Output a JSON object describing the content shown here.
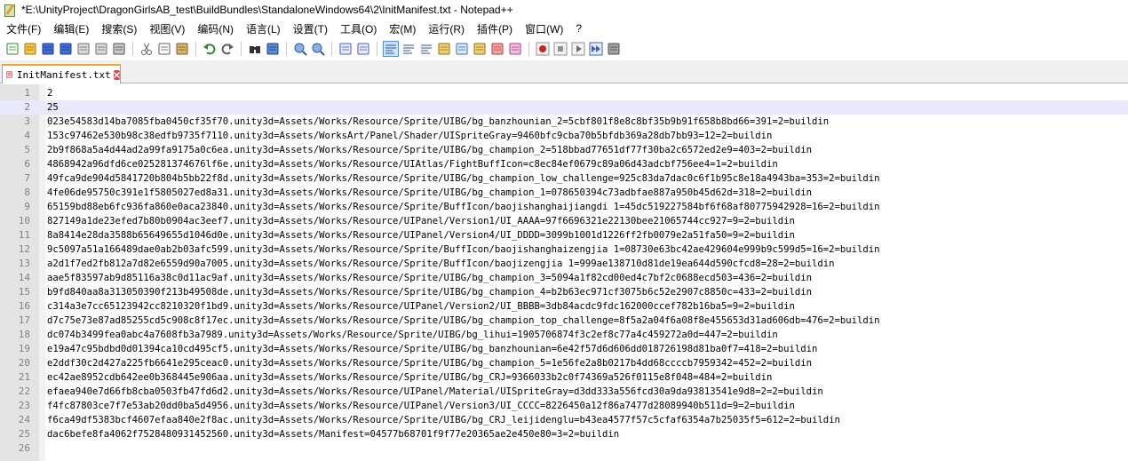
{
  "window": {
    "title": "*E:\\UnityProject\\DragonGirlsAB_test\\BuildBundles\\StandaloneWindows64\\2\\InitManifest.txt - Notepad++"
  },
  "menu": [
    "文件(F)",
    "编辑(E)",
    "搜索(S)",
    "视图(V)",
    "编码(N)",
    "语言(L)",
    "设置(T)",
    "工具(O)",
    "宏(M)",
    "运行(R)",
    "插件(P)",
    "窗口(W)",
    "?"
  ],
  "tab": {
    "label": "InitManifest.txt"
  },
  "editor": {
    "current_line": 2,
    "lines": [
      "2",
      "25",
      "023e54583d14ba7085fba0450cf35f70.unity3d=Assets/Works/Resource/Sprite/UIBG/bg_banzhounian_2=5cbf801f8e8c8bf35b9b91f658b8bd66=391=2=buildin",
      "153c97462e530b98c38edfb9735f7110.unity3d=Assets/WorksArt/Panel/Shader/UISpriteGray=9460bfc9cba70b5bfdb369a28db7bb93=12=2=buildin",
      "2b9f868a5a4d44ad2a99fa9175a0c6ea.unity3d=Assets/Works/Resource/Sprite/UIBG/bg_champion_2=518bbad77651df77f30ba2c6572ed2e9=403=2=buildin",
      "4868942a96dfd6ce025281374676lf6e.unity3d=Assets/Works/Resource/UIAtlas/FightBuffIcon=c8ec84ef0679c89a06d43adcbf756ee4=1=2=buildin",
      "49fca9de904d5841720b804b5bb22f8d.unity3d=Assets/Works/Resource/Sprite/UIBG/bg_champion_low_challenge=925c83da7dac0c6f1b95c8e18a4943ba=353=2=buildin",
      "4fe06de95750c391e1f5805027ed8a31.unity3d=Assets/Works/Resource/Sprite/UIBG/bg_champion_1=078650394c73adbfae887a950b45d62d=318=2=buildin",
      "65159bd88eb6fc936fa860e0aca23840.unity3d=Assets/Works/Resource/Sprite/BuffIcon/baojishanghaijiangdi 1=45dc519227584bf6f68af80775942928=16=2=buildin",
      "827149a1de23efed7b80b0904ac3eef7.unity3d=Assets/Works/Resource/UIPanel/Version1/UI_AAAA=97f6696321e22130bee21065744cc927=9=2=buildin",
      "8a8414e28da3588b65649655d1046d0e.unity3d=Assets/Works/Resource/UIPanel/Version4/UI_DDDD=3099b1001d1226ff2fb0079e2a51fa50=9=2=buildin",
      "9c5097a51a166489dae0ab2b03afc599.unity3d=Assets/Works/Resource/Sprite/BuffIcon/baojishanghaizengjia 1=08730e63bc42ae429604e999b9c599d5=16=2=buildin",
      "a2d1f7ed2fb812a7d82e6559d90a7005.unity3d=Assets/Works/Resource/Sprite/BuffIcon/baojizengjia 1=999ae138710d81de19ea644d590cfcd8=28=2=buildin",
      "aae5f83597ab9d85116a38c0d11ac9af.unity3d=Assets/Works/Resource/Sprite/UIBG/bg_champion_3=5094a1f82cd00ed4c7bf2c0688ecd503=436=2=buildin",
      "b9fd840aa8a313050390f213b49508de.unity3d=Assets/Works/Resource/Sprite/UIBG/bg_champion_4=b2b63ec971cf3075b6c52e2907c8850c=433=2=buildin",
      "c314a3e7cc65123942cc8210320f1bd9.unity3d=Assets/Works/Resource/UIPanel/Version2/UI_BBBB=3db84acdc9fdc162000ccef782b16ba5=9=2=buildin",
      "d7c75e73e87ad85255cd5c908c8f17ec.unity3d=Assets/Works/Resource/Sprite/UIBG/bg_champion_top_challenge=8f5a2a04f6a08f8e455653d31ad606db=476=2=buildin",
      "dc074b3499fea0abc4a7608fb3a7989.unity3d=Assets/Works/Resource/Sprite/UIBG/bg_lihui=1905706874f3c2ef8c77a4c459272a0d=447=2=buildin",
      "e19a47c95bdbd0d01394ca10cd495cf5.unity3d=Assets/Works/Resource/Sprite/UIBG/bg_banzhounian=6e42f57d6d606dd018726198d81ba0f7=418=2=buildin",
      "e2ddf30c2d427a225fb6641e295ceac0.unity3d=Assets/Works/Resource/Sprite/UIBG/bg_champion_5=1e56fe2a8b0217b4dd68ccccb7959342=452=2=buildin",
      "ec42ae8952cdb642ee0b368445e906aa.unity3d=Assets/Works/Resource/Sprite/UIBG/bg_CRJ=9366033b2c0f74369a526f0115e8f048=484=2=buildin",
      "efaea940e7d66fb8cba0503fb47fd6d2.unity3d=Assets/Works/Resource/UIPanel/Material/UISpriteGray=d3dd333a556fcd30a9da93813541e9d8=2=2=buildin",
      "f4fc87803ce7f7e53ab20dd0ba5d4956.unity3d=Assets/Works/Resource/UIPanel/Version3/UI_CCCC=8226450a12f86a7477d28089940b511d=9=2=buildin",
      "f6ca49df5383bcf4607efaa840e2f8ac.unity3d=Assets/Works/Resource/Sprite/UIBG/bg_CRJ_leijidenglu=b43ea4577f57c5cfaf6354a7b25035f5=612=2=buildin",
      "dac6befe8fa4062f7528480931452560.unity3d=Assets/Manifest=04577b68701f9f77e20365ae2e450e80=3=2=buildin",
      ""
    ]
  },
  "toolbar_icons": [
    "new-file-icon",
    "open-file-icon",
    "save-icon",
    "save-all-icon",
    "close-icon",
    "close-all-icon",
    "print-icon",
    "|",
    "cut-icon",
    "copy-icon",
    "paste-icon",
    "|",
    "undo-icon",
    "redo-icon",
    "|",
    "find-icon",
    "replace-icon",
    "|",
    "zoom-in-icon",
    "zoom-out-icon",
    "|",
    "sync-vertical-icon",
    "sync-horizontal-icon",
    "|",
    "word-wrap-icon",
    "show-all-chars-icon",
    "indent-guide-icon",
    "user-language-icon",
    "doc-map-icon",
    "function-list-icon",
    "folder-workspace-icon",
    "monitoring-icon",
    "|",
    "record-macro-icon",
    "stop-record-icon",
    "play-macro-icon",
    "run-macro-multiple-icon",
    "save-macro-icon"
  ],
  "colors": {
    "gutter": "#e4e4e4",
    "current_line": "#e8e8ff",
    "tab_accent": "#f5a623",
    "record_red": "#d02020"
  }
}
